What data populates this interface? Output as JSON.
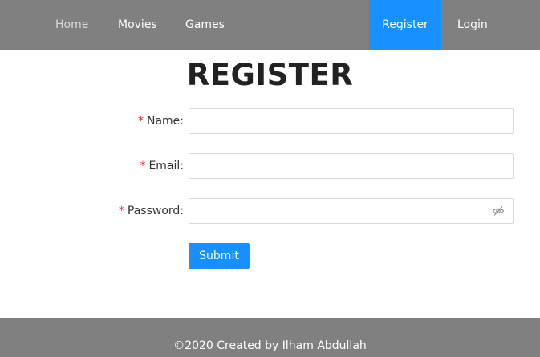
{
  "nav": {
    "items": [
      {
        "label": "Home"
      },
      {
        "label": "Movies"
      },
      {
        "label": "Games"
      },
      {
        "label": "Register",
        "active": true
      },
      {
        "label": "Login"
      }
    ]
  },
  "page": {
    "title": "REGISTER"
  },
  "form": {
    "required_mark": "*",
    "fields": [
      {
        "label": "Name:",
        "value": "",
        "type": "text"
      },
      {
        "label": "Email:",
        "value": "",
        "type": "email"
      },
      {
        "label": "Password:",
        "value": "",
        "type": "password",
        "icon": "eye-invisible-icon"
      }
    ],
    "submit_label": "Submit"
  },
  "footer": {
    "text": "©2020 Created by Ilham Abdullah"
  },
  "colors": {
    "nav_bg": "#808080",
    "accent": "#1890ff",
    "required": "#f5222d",
    "footer_bg": "#808080"
  }
}
